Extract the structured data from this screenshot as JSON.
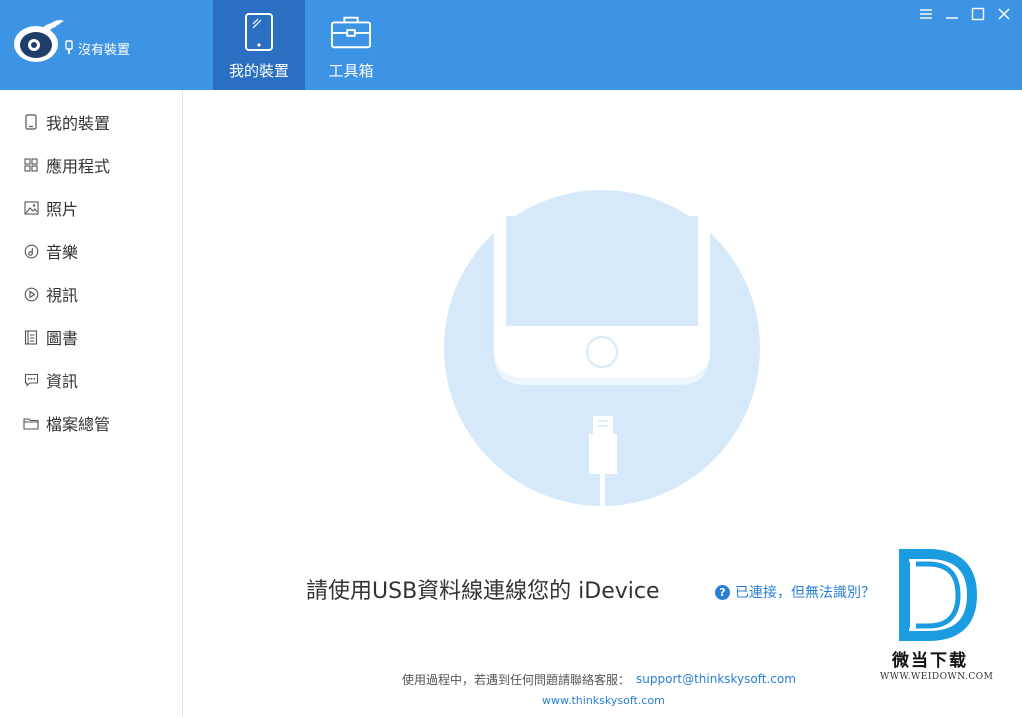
{
  "header": {
    "device_status": "沒有裝置",
    "tabs": [
      {
        "label": "我的裝置",
        "icon": "tablet-icon",
        "active": true
      },
      {
        "label": "工具箱",
        "icon": "toolbox-icon",
        "active": false
      }
    ],
    "window_controls": [
      "menu-icon",
      "minimize-icon",
      "maximize-icon",
      "close-icon"
    ]
  },
  "sidebar": {
    "items": [
      {
        "label": "我的裝置",
        "icon": "phone-icon"
      },
      {
        "label": "應用程式",
        "icon": "apps-grid-icon"
      },
      {
        "label": "照片",
        "icon": "photo-icon"
      },
      {
        "label": "音樂",
        "icon": "music-icon"
      },
      {
        "label": "視訊",
        "icon": "video-play-icon"
      },
      {
        "label": "圖書",
        "icon": "book-icon"
      },
      {
        "label": "資訊",
        "icon": "message-icon"
      },
      {
        "label": "檔案總管",
        "icon": "folder-icon"
      }
    ]
  },
  "main": {
    "prompt": "請使用USB資料線連線您的 iDevice",
    "help_link": "已連接，但無法識別？",
    "support_text": "使用過程中，若遇到任何問題請聯絡客服：",
    "support_email": "support@thinkskysoft.com",
    "website": "www.thinkskysoft.com"
  },
  "watermark": {
    "name": "微当下载",
    "url": "WWW.WEIDOWN.COM"
  },
  "colors": {
    "header_bg": "#3d93e4",
    "active_tab_bg": "#2a6fc1",
    "illustration_circle": "#d6e9fa",
    "link": "#2a7fd4"
  }
}
